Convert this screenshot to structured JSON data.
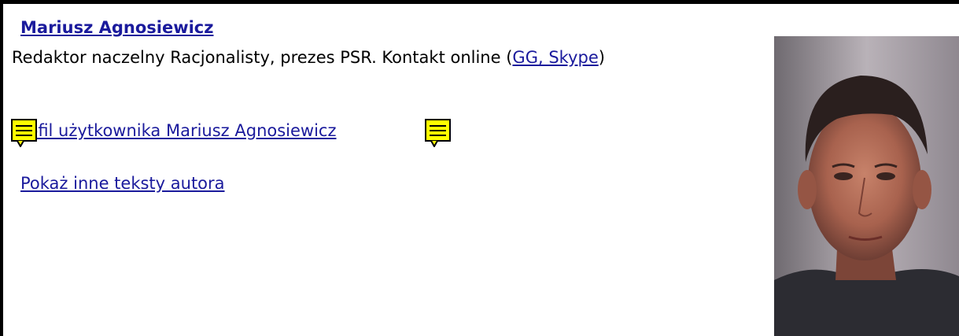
{
  "author": {
    "name": "Mariusz Agnosiewicz",
    "bio_text": "Redaktor naczelny Racjonalisty, prezes PSR. Kontakt online (",
    "bio_link": "GG, Skype",
    "bio_close": ")"
  },
  "links": {
    "profile": "Profil użytkownika Mariusz Agnosiewicz",
    "more_texts": "Pokaż inne teksty autora"
  },
  "icons": {
    "note_icon": "note-icon",
    "note_color": "#ffff00"
  },
  "photo": {
    "alt": "author-photo"
  }
}
